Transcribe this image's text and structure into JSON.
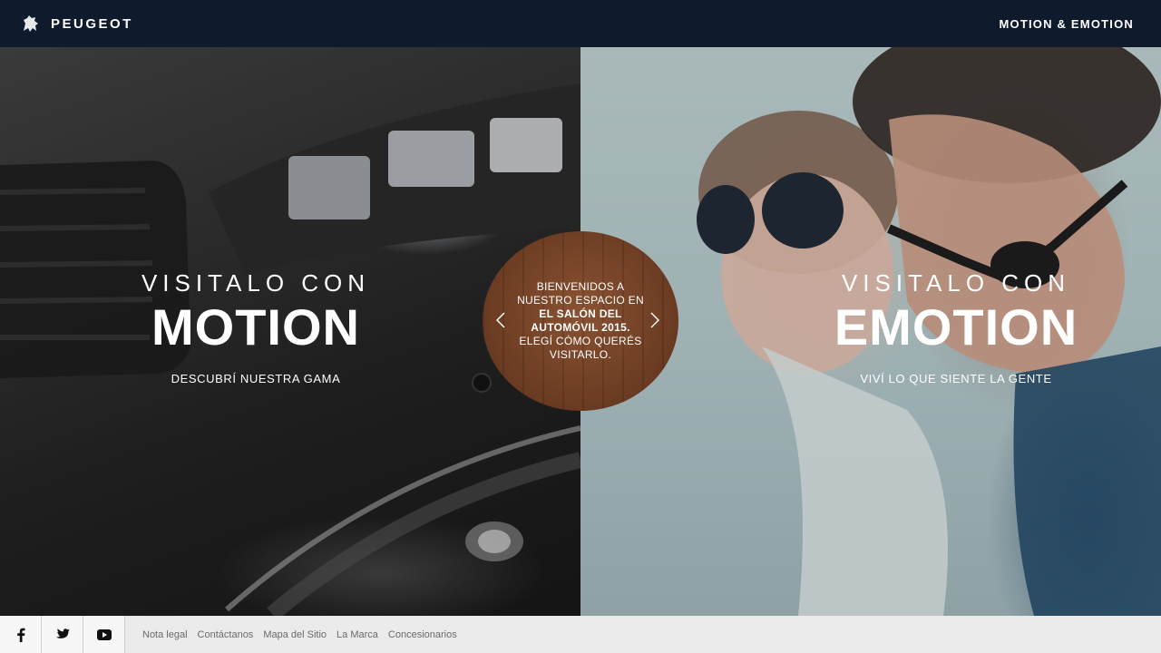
{
  "header": {
    "brand_name": "PEUGEOT",
    "tagline": "MOTION & EMOTION"
  },
  "motion_panel": {
    "pre_title": "VISITALO CON",
    "title": "MOTION",
    "subtitle": "DESCUBRÍ NUESTRA GAMA"
  },
  "emotion_panel": {
    "pre_title": "VISITALO CON",
    "title": "EMOTION",
    "subtitle": "VIVÍ LO QUE SIENTE LA GENTE"
  },
  "badge": {
    "line1": "BIENVENIDOS A NUESTRO ESPACIO EN",
    "highlight": "EL SALÓN DEL AUTOMÓVIL 2015.",
    "line2": "ELEGÍ CÓMO QUERÉS VISITARLO."
  },
  "footer": {
    "social": [
      "facebook-icon",
      "twitter-icon",
      "youtube-icon"
    ],
    "links": [
      "Nota legal",
      "Contáctanos",
      "Mapa del Sitio",
      "La Marca",
      "Concesionarios"
    ]
  },
  "colors": {
    "header_bg": "#0f1b2d",
    "footer_bg": "#ebebeb",
    "badge_wood": "#6e3e24"
  }
}
